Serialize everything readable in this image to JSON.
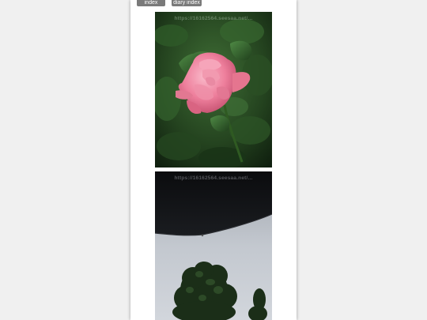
{
  "nav": {
    "index_label": "index",
    "diary_label": "diary index"
  },
  "photos": [
    {
      "subject": "pink-rose",
      "watermark": "https://16162564.seesaa.net/..."
    },
    {
      "subject": "umbrella-and-tree",
      "watermark": "https://16162564.seesaa.net/..."
    }
  ],
  "colors": {
    "page_background": "#f0f0f0",
    "content_background": "#ffffff",
    "nav_button": "#7a7a7a",
    "rose_pink": "#f08aa6",
    "foliage_dark": "#1f3a1c",
    "umbrella_black": "#111214",
    "sky_grey": "#b9bfc6"
  }
}
